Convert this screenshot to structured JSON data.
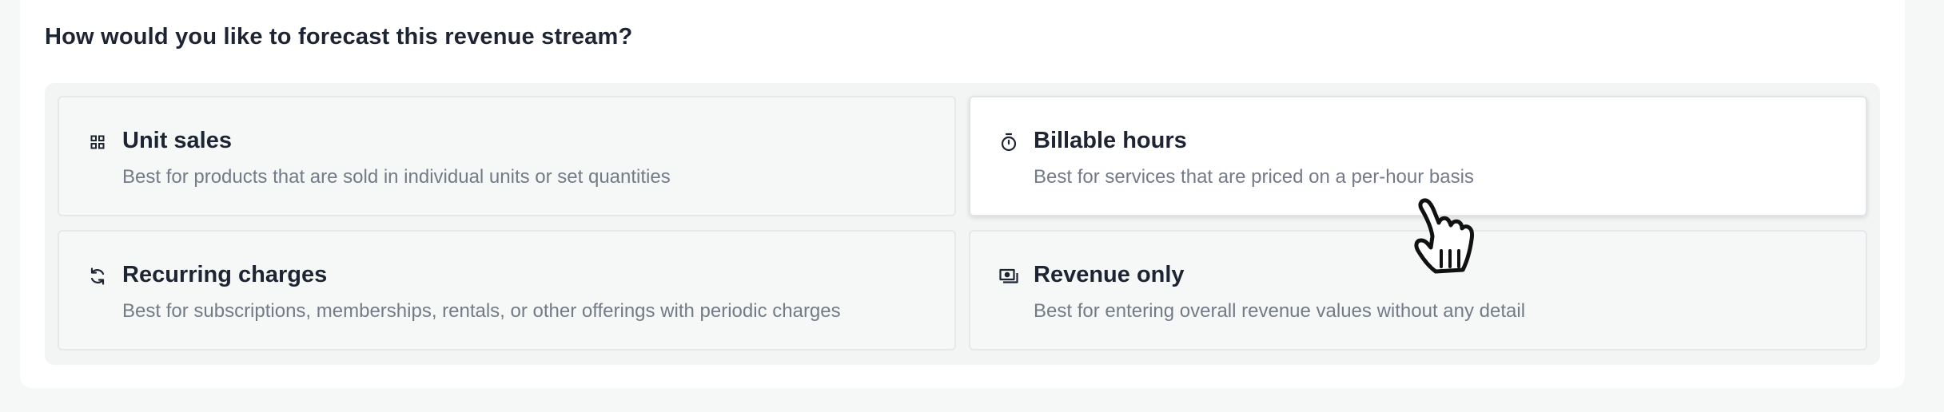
{
  "question": "How would you like to forecast this revenue stream?",
  "options": [
    {
      "title": "Unit sales",
      "description": "Best for products that are sold in individual units or set quantities",
      "icon": "grid-icon",
      "selected": false
    },
    {
      "title": "Billable hours",
      "description": "Best for services that are priced on a per-hour basis",
      "icon": "stopwatch-icon",
      "selected": true
    },
    {
      "title": "Recurring charges",
      "description": "Best for subscriptions, memberships, rentals, or other offerings with periodic charges",
      "icon": "refresh-icon",
      "selected": false
    },
    {
      "title": "Revenue only",
      "description": "Best for entering overall revenue values without any detail",
      "icon": "cash-icon",
      "selected": false
    }
  ],
  "colors": {
    "text_primary": "#1e2532",
    "text_secondary": "#737b88",
    "option_background": "#f6f7f7",
    "option_selected_background": "#ffffff",
    "option_border": "#e5e8ea",
    "page_background": "#f6f7f7"
  }
}
